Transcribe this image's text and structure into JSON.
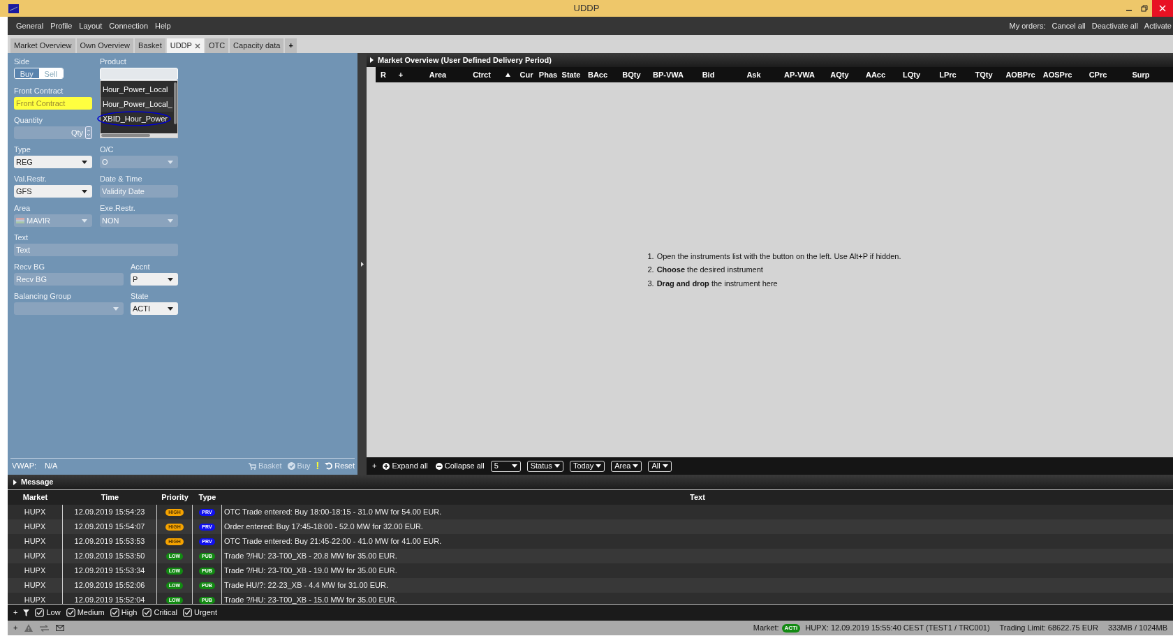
{
  "window": {
    "title": "UDDP"
  },
  "menu": [
    "General",
    "Profile",
    "Layout",
    "Connection",
    "Help"
  ],
  "orders_menu": {
    "label": "My orders:",
    "actions": [
      "Cancel all",
      "Deactivate all",
      "Activate"
    ]
  },
  "tabs": [
    {
      "label": "Market Overview",
      "selected": false,
      "closable": false
    },
    {
      "label": "Own Overview",
      "selected": false,
      "closable": false
    },
    {
      "label": "Basket",
      "selected": false,
      "closable": false
    },
    {
      "label": "UDDP",
      "selected": true,
      "closable": true
    },
    {
      "label": "OTC",
      "selected": false,
      "closable": false
    },
    {
      "label": "Capacity data",
      "selected": false,
      "closable": false
    }
  ],
  "add_tab": "+",
  "order_form": {
    "rows": [
      {
        "fields": [
          {
            "kind": "toggle",
            "label": "Side",
            "options": [
              {
                "label": "Buy",
                "selected": true
              },
              {
                "label": "Sell",
                "selected": false
              }
            ]
          },
          {
            "kind": "combo",
            "label": "Product",
            "expanded": true,
            "options": [
              {
                "label": "Hour_Power_Local",
                "annotated": false
              },
              {
                "label": "Hour_Power_Local_",
                "annotated": false
              },
              {
                "label": "XBID_Hour_Power",
                "annotated": true
              }
            ]
          }
        ]
      },
      {
        "fields": [
          {
            "kind": "text",
            "label": "Front Contract",
            "placeholder": "Front Contract",
            "highlighted": true
          }
        ]
      },
      {
        "fields": [
          {
            "kind": "spin",
            "label": "Quantity",
            "placeholder": "Qty",
            "disabled": true
          }
        ]
      },
      {
        "fields": [
          {
            "kind": "select",
            "label": "Type",
            "value": "REG",
            "disabled": false
          },
          {
            "kind": "select",
            "label": "O/C",
            "value": "O",
            "disabled": true
          }
        ]
      },
      {
        "fields": [
          {
            "kind": "select",
            "label": "Val.Restr.",
            "value": "GFS",
            "disabled": false
          },
          {
            "kind": "text",
            "label": "Date & Time",
            "placeholder": "Validity Date",
            "disabled": true
          }
        ]
      },
      {
        "fields": [
          {
            "kind": "select",
            "label": "Area",
            "value": "MAVIR",
            "disabled": true,
            "flag": true
          },
          {
            "kind": "select",
            "label": "Exe.Restr.",
            "value": "NON",
            "disabled": true
          }
        ]
      },
      {
        "fields": [
          {
            "kind": "text",
            "label": "Text",
            "placeholder": "Text",
            "disabled": true
          }
        ]
      },
      {
        "fields": [
          {
            "kind": "text",
            "label": "Recv BG",
            "placeholder": "Recv BG",
            "disabled": true
          },
          {
            "kind": "select",
            "label": "Accnt",
            "value": "P",
            "disabled": false
          }
        ]
      },
      {
        "fields": [
          {
            "kind": "select",
            "label": "Balancing Group",
            "disabled": true
          },
          {
            "kind": "select",
            "label": "State",
            "value": "ACTI",
            "disabled": false
          }
        ]
      }
    ]
  },
  "form_footer": {
    "vwap_label": "VWAP:",
    "vwap_value": "N/A",
    "buttons": [
      {
        "kind": "basket",
        "label": "Basket",
        "disabled": true
      },
      {
        "kind": "buy",
        "label": "Buy",
        "disabled": true
      },
      {
        "kind": "warning",
        "label": "!"
      },
      {
        "kind": "reset",
        "label": "Reset",
        "disabled": false
      }
    ]
  },
  "market_overview": {
    "title": "Market Overview (User Defined Delivery Period)",
    "columns": [
      {
        "label": "R"
      },
      {
        "label": "+"
      },
      {
        "label": "Area"
      },
      {
        "label": "Ctrct",
        "sorted": true
      },
      {
        "label": "Cur"
      },
      {
        "label": "Phas"
      },
      {
        "label": "State"
      },
      {
        "label": "BAcc"
      },
      {
        "label": "BQty"
      },
      {
        "label": "BP-VWA"
      },
      {
        "label": "Bid"
      },
      {
        "label": "Ask"
      },
      {
        "label": "AP-VWA"
      },
      {
        "label": "AQty"
      },
      {
        "label": "AAcc"
      },
      {
        "label": "LQty"
      },
      {
        "label": "LPrc"
      },
      {
        "label": "TQty"
      },
      {
        "label": "AOBPrc"
      },
      {
        "label": "AOSPrc"
      },
      {
        "label": "CPrc"
      },
      {
        "label": "Surp"
      }
    ],
    "instructions": [
      {
        "number": "1.",
        "text": "Open the instruments list with the button on the left. Use Alt+P if hidden."
      },
      {
        "number": "2.",
        "text": "**Choose** the desired instrument"
      },
      {
        "number": "3.",
        "text": "**Drag and drop** the instrument here"
      }
    ],
    "toolbar": {
      "add": "+",
      "expand": "Expand all",
      "collapse": "Collapse all",
      "dropdowns": [
        "5",
        "Status",
        "Today",
        "Area",
        "All"
      ]
    }
  },
  "messages": {
    "title": "Message",
    "columns": [
      "Market",
      "Time",
      "Priority",
      "Type",
      "Text"
    ],
    "rows": [
      {
        "market": "HUPX",
        "time": "12.09.2019 15:54:23",
        "priority": {
          "label": "HIGH",
          "color": "#f5a300"
        },
        "type": {
          "label": "PRV",
          "color": "#1010f0"
        },
        "text": "OTC Trade entered: Buy 18:00-18:15 - 31.0 MW for 54.00 EUR."
      },
      {
        "market": "HUPX",
        "time": "12.09.2019 15:54:07",
        "priority": {
          "label": "HIGH",
          "color": "#f5a300"
        },
        "type": {
          "label": "PRV",
          "color": "#1010f0"
        },
        "text": "Order entered: Buy 17:45-18:00 - 52.0 MW for 32.00 EUR."
      },
      {
        "market": "HUPX",
        "time": "12.09.2019 15:53:53",
        "priority": {
          "label": "HIGH",
          "color": "#f5a300"
        },
        "type": {
          "label": "PRV",
          "color": "#1010f0"
        },
        "text": "OTC Trade entered: Buy 21:45-22:00 - 41.0 MW for 41.00 EUR."
      },
      {
        "market": "HUPX",
        "time": "12.09.2019 15:53:50",
        "priority": {
          "label": "LOW",
          "color": "#128a12"
        },
        "type": {
          "label": "PUB",
          "color": "#128a12"
        },
        "text": "Trade ?/HU: 23-T00_XB - 20.8 MW for 35.00 EUR."
      },
      {
        "market": "HUPX",
        "time": "12.09.2019 15:53:34",
        "priority": {
          "label": "LOW",
          "color": "#128a12"
        },
        "type": {
          "label": "PUB",
          "color": "#128a12"
        },
        "text": "Trade ?/HU: 23-T00_XB - 19.0 MW for 35.00 EUR."
      },
      {
        "market": "HUPX",
        "time": "12.09.2019 15:52:06",
        "priority": {
          "label": "LOW",
          "color": "#128a12"
        },
        "type": {
          "label": "PUB",
          "color": "#128a12"
        },
        "text": "Trade HU/?: 22-23_XB - 4.4 MW for 31.00 EUR."
      },
      {
        "market": "HUPX",
        "time": "12.09.2019 15:52:04",
        "priority": {
          "label": "LOW",
          "color": "#128a12"
        },
        "type": {
          "label": "PUB",
          "color": "#128a12"
        },
        "text": "Trade ?/HU: 23-T00_XB - 15.0 MW for 35.00 EUR."
      }
    ],
    "filter": {
      "add": "+",
      "levels": [
        {
          "label": "Low",
          "checked": true
        },
        {
          "label": "Medium",
          "checked": true
        },
        {
          "label": "High",
          "checked": true
        },
        {
          "label": "Critical",
          "checked": true
        },
        {
          "label": "Urgent",
          "checked": true
        }
      ]
    }
  },
  "status_bar": {
    "add": "+",
    "market_label": "Market:",
    "market_state": "ACTI",
    "session": "HUPX: 12.09.2019 15:55:40 CEST (TEST1 / TRC001)",
    "trading_limit": "Trading Limit: 68622.75 EUR",
    "memory": "333MB / 1024MB"
  }
}
